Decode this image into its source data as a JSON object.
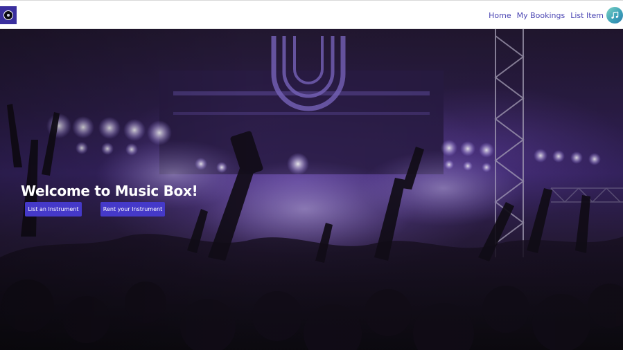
{
  "nav": {
    "logo_icon": "music-box-logo-icon",
    "links": [
      {
        "label": "Home"
      },
      {
        "label": "My Bookings"
      },
      {
        "label": "List Item"
      }
    ],
    "avatar_icon": "music-note-icon"
  },
  "hero": {
    "title": "Welcome to Music Box!",
    "buttons": [
      {
        "label": "List an Instrument"
      },
      {
        "label": "Rent your Instrument"
      }
    ],
    "background_image": "concert-crowd-stage-lights-image"
  },
  "colors": {
    "brand": "#4539c9",
    "nav_link": "#4a45b3",
    "navbar_bg": "#ffffff",
    "logo_bg": "#3a2f9e"
  }
}
